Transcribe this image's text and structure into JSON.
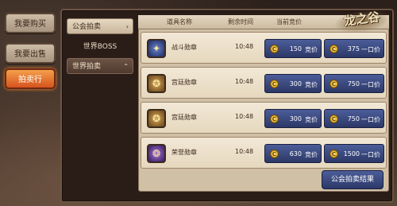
{
  "side_menu": [
    {
      "label": "我要购买",
      "active": false
    },
    {
      "label": "我要出售",
      "active": false
    },
    {
      "label": "拍卖行",
      "active": true
    }
  ],
  "categories": [
    {
      "label": "公会拍卖",
      "caret": "›",
      "style": "light"
    },
    {
      "label": "世界BOSS",
      "caret": "",
      "style": "plain"
    },
    {
      "label": "世界拍卖",
      "caret": "⌃",
      "style": "dark"
    }
  ],
  "table": {
    "headers": [
      "道具名称",
      "剩余时间",
      "当前竞价"
    ],
    "rows": [
      {
        "name": "战斗勋章",
        "time": "10:48",
        "bid": "150",
        "bid_label": "竞价",
        "buyout": "375",
        "buyout_label": "一口价",
        "icon": "battle-medal-icon",
        "icon_color": "#3b4f9a"
      },
      {
        "name": "宫廷勋章",
        "time": "10:48",
        "bid": "300",
        "bid_label": "竞价",
        "buyout": "750",
        "buyout_label": "一口价",
        "icon": "court-medal-icon",
        "icon_color": "#a0702f"
      },
      {
        "name": "宫廷勋章",
        "time": "10:48",
        "bid": "300",
        "bid_label": "竞价",
        "buyout": "750",
        "buyout_label": "一口价",
        "icon": "court-medal-icon",
        "icon_color": "#a0702f"
      },
      {
        "name": "荣誉勋章",
        "time": "10:48",
        "bid": "630",
        "bid_label": "竞价",
        "buyout": "1500",
        "buyout_label": "一口价",
        "icon": "honor-medal-icon",
        "icon_color": "#6a3f9a"
      }
    ]
  },
  "coin_symbol": "C",
  "result_button": "公会拍卖结果",
  "logo_text": "龙之谷"
}
